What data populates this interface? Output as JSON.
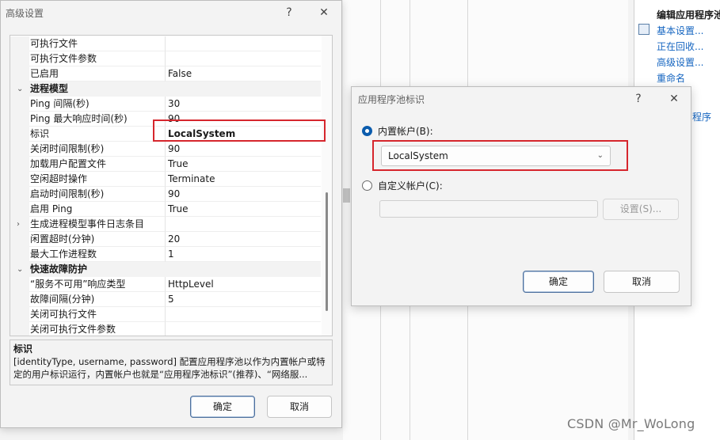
{
  "background": {
    "actions_title": "编辑应用程序池",
    "actions": [
      "基本设置...",
      "正在回收...",
      "高级设置...",
      "重命名"
    ],
    "pool_link": "程序"
  },
  "advanced_dialog": {
    "title": "高级设置",
    "help_glyph": "?",
    "close_glyph": "✕",
    "rows": [
      {
        "type": "prop",
        "name": "可执行文件",
        "value": ""
      },
      {
        "type": "prop",
        "name": "可执行文件参数",
        "value": ""
      },
      {
        "type": "prop",
        "name": "已启用",
        "value": "False"
      },
      {
        "type": "cat",
        "name": "进程模型",
        "expander": "⌄"
      },
      {
        "type": "prop",
        "name": "Ping 间隔(秒)",
        "value": "30"
      },
      {
        "type": "prop",
        "name": "Ping 最大响应时间(秒)",
        "value": "90"
      },
      {
        "type": "prop",
        "name": "标识",
        "value": "LocalSystem",
        "bold": true
      },
      {
        "type": "prop",
        "name": "关闭时间限制(秒)",
        "value": "90"
      },
      {
        "type": "prop",
        "name": "加载用户配置文件",
        "value": "True"
      },
      {
        "type": "prop",
        "name": "空闲超时操作",
        "value": "Terminate"
      },
      {
        "type": "prop",
        "name": "启动时间限制(秒)",
        "value": "90"
      },
      {
        "type": "prop",
        "name": "启用 Ping",
        "value": "True"
      },
      {
        "type": "prop",
        "name": "生成进程模型事件日志条目",
        "value": "",
        "expander": "›"
      },
      {
        "type": "prop",
        "name": "闲置超时(分钟)",
        "value": "20"
      },
      {
        "type": "prop",
        "name": "最大工作进程数",
        "value": "1"
      },
      {
        "type": "cat",
        "name": "快速故障防护",
        "expander": "⌄"
      },
      {
        "type": "prop",
        "name": "“服务不可用”响应类型",
        "value": "HttpLevel"
      },
      {
        "type": "prop",
        "name": "故障间隔(分钟)",
        "value": "5"
      },
      {
        "type": "prop",
        "name": "关闭可执行文件",
        "value": ""
      },
      {
        "type": "prop",
        "name": "关闭可执行文件参数",
        "value": ""
      }
    ],
    "description": {
      "title": "标识",
      "text": "[identityType, username, password] 配置应用程序池以作为内置帐户或特定的用户标识运行，内置帐户也就是“应用程序池标识”(推荐)、“网络服..."
    },
    "ok_label": "确定",
    "cancel_label": "取消"
  },
  "identity_dialog": {
    "title": "应用程序池标识",
    "help_glyph": "?",
    "close_glyph": "✕",
    "builtin_label": "内置帐户(B):",
    "builtin_value": "LocalSystem",
    "chevron": "⌄",
    "custom_label": "自定义帐户(C):",
    "custom_value": "",
    "set_label": "设置(S)...",
    "ok_label": "确定",
    "cancel_label": "取消"
  },
  "watermark": "CSDN @Mr_WoLong",
  "colors": {
    "highlight_box": "#d6262d",
    "accent": "#0b5cad",
    "link": "#1565c0"
  }
}
